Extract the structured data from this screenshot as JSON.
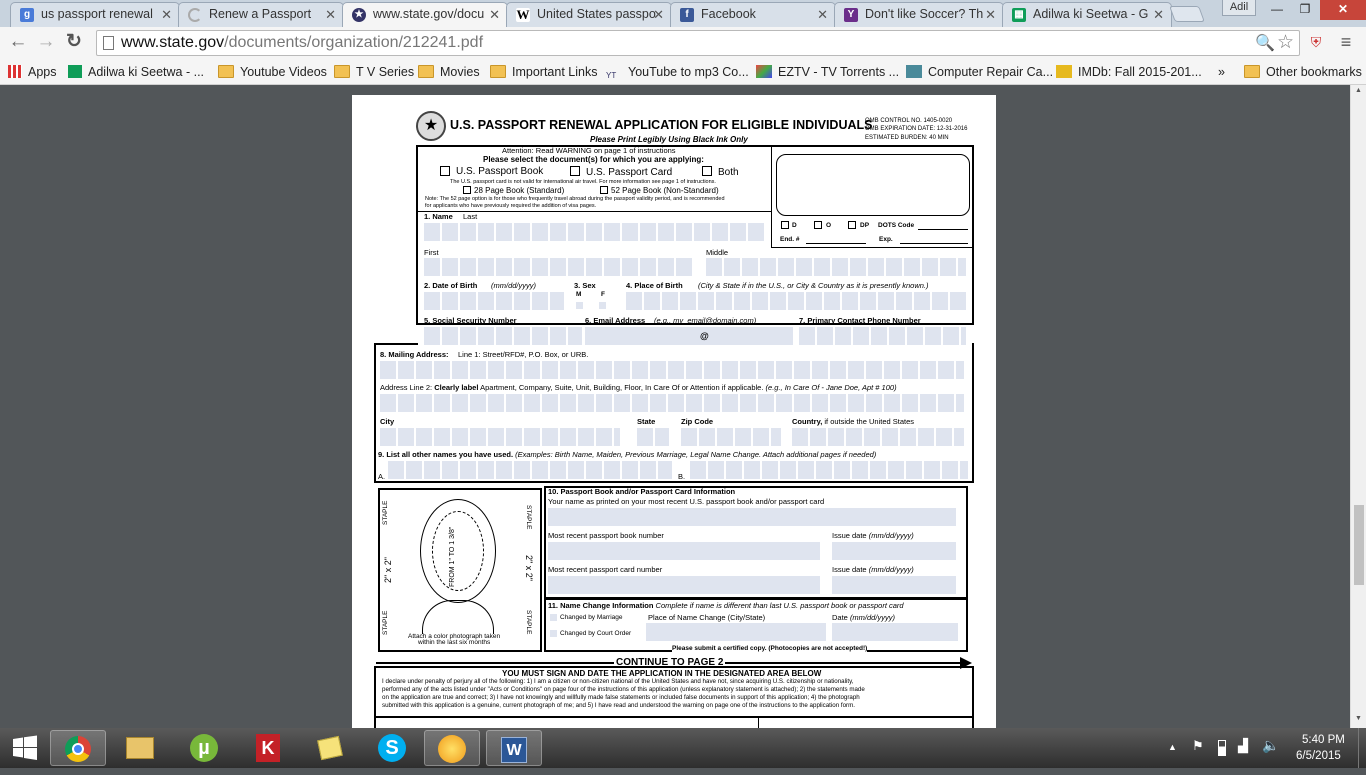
{
  "tabs": [
    {
      "label": "us passport renewal",
      "icon": "google-icon",
      "color": "#4a7bd8"
    },
    {
      "label": "Renew a Passport",
      "icon": "loading-icon",
      "color": "#999999"
    },
    {
      "label": "www.state.gov/docu",
      "icon": "state-seal-icon",
      "color": "#333366"
    },
    {
      "label": "United States passpo",
      "icon": "wikipedia-icon",
      "color": "#555555"
    },
    {
      "label": "Facebook",
      "icon": "facebook-icon",
      "color": "#3b5998"
    },
    {
      "label": "Don't like Soccer? Th",
      "icon": "yahoo-icon",
      "color": "#6b2e8a"
    },
    {
      "label": "Adilwa ki Seetwa - G",
      "icon": "sheets-icon",
      "color": "#0f9d58"
    }
  ],
  "window": {
    "user": "Adil",
    "minimize": "—",
    "restore": "❐",
    "close": "✕"
  },
  "toolbar": {
    "back": "←",
    "forward": "→",
    "reload": "↻",
    "url_host": "www.state.gov",
    "url_path": "/documents/organization/212241.pdf",
    "zoom": "🔍",
    "star": "☆",
    "menu": "≡"
  },
  "bookmarks": [
    {
      "label": "Apps",
      "type": "apps"
    },
    {
      "label": "Adilwa ki Seetwa - ...",
      "type": "sheets"
    },
    {
      "label": "Youtube Videos",
      "type": "folder"
    },
    {
      "label": "T V Series",
      "type": "folder"
    },
    {
      "label": "Movies",
      "type": "folder"
    },
    {
      "label": "Important Links",
      "type": "folder"
    },
    {
      "label": "YouTube to mp3 Co...",
      "type": "yt"
    },
    {
      "label": "EZTV - TV Torrents ...",
      "type": "eztv"
    },
    {
      "label": "Computer Repair Ca...",
      "type": "hj"
    },
    {
      "label": "IMDb: Fall 2015-201...",
      "type": "imdb"
    },
    {
      "label": "»",
      "type": "more"
    },
    {
      "label": "Other bookmarks",
      "type": "folder"
    }
  ],
  "form": {
    "title": "U.S. PASSPORT RENEWAL APPLICATION FOR ELIGIBLE INDIVIDUALS",
    "print_note": "Please Print Legibly Using Black Ink Only",
    "omb1": "OMB CONTROL NO. 1405-0020",
    "omb2": "OMB EXPIRATION DATE:  12-31-2016",
    "omb3": "ESTIMATED BURDEN: 40 MIN",
    "attention": "Attention: Read WARNING on page 1 of instructions",
    "select_docs": "Please select the document(s) for which you are applying:",
    "opt_book": "U.S. Passport Book",
    "opt_card": "U.S. Passport Card",
    "opt_both": "Both",
    "card_note": "The U.S. passport card is not valid for international air travel. For more information see page 1 of instructions.",
    "opt_28": "28 Page Book (Standard)",
    "opt_52": "52 Page Book (Non-Standard)",
    "note": "Note: The 52 page option is for those who frequently travel abroad during the passport validity period, and is recommended",
    "note2": "for applicants who have previously required the addition of visa pages.",
    "d": "D",
    "o": "O",
    "dp": "DP",
    "dots": "DOTS Code",
    "end": "End. #",
    "exp": "Exp.",
    "f1": "1.  Name",
    "last": "Last",
    "first": "First",
    "middle": "Middle",
    "f2": "2.  Date of Birth",
    "f2i": "(mm/dd/yyyy)",
    "f3": "3.  Sex",
    "m": "M",
    "f": "F",
    "f4": "4.  Place of Birth",
    "f4i": "(City & State if in the U.S., or City & Country as it is presently known.)",
    "f5": "5.  Social Security Number",
    "f6": "6. Email Address",
    "f6i": "(e.g., my_email@domain.com)",
    "at": "@",
    "f7": "7. Primary Contact Phone Number",
    "f8": "8. Mailing Address:",
    "f8r": "Line 1: Street/RFD#, P.O. Box, or URB.",
    "addr2a": "Address Line 2:",
    "addr2b": "Clearly label",
    "addr2c": "Apartment, Company, Suite, Unit, Building, Floor, In Care Of or Attention if applicable.",
    "addr2d": "(e.g., In Care Of - Jane Doe, Apt # 100)",
    "city": "City",
    "state": "State",
    "zip": "Zip Code",
    "country": "Country,",
    "country2": "if outside the United States",
    "f9": "9. List all other names you have used.",
    "f9i": "(Examples: Birth Name, Maiden, Previous Marriage, Legal Name Change.  Attach additional  pages if needed)",
    "a": "A.",
    "b": "B.",
    "staple": "STAPLE",
    "size": "2\" x 2\"",
    "from": "FROM 1\" TO 1 3/8\"",
    "attach1": "Attach a color photograph taken",
    "attach2": "within the last six months",
    "f10": "10. Passport Book and/or Passport Card Information",
    "f10a": "Your name as printed on your most recent U.S. passport book and/or passport card",
    "book_num": "Most recent passport book number",
    "issue": "Issue date",
    "issue_i": "(mm/dd/yyyy)",
    "card_num": "Most recent passport card number",
    "f11": "11. Name Change Information",
    "f11i": "Complete if name is different than last U.S. passport book or passport card",
    "marriage": "Changed by Marriage",
    "court": "Changed by Court Order",
    "place_change": "Place of Name Change (City/State)",
    "date": "Date",
    "date_i": "(mm/dd/yyyy)",
    "certified": "Please submit a certified copy.  (Photocopies are not accepted!)",
    "continue": "CONTINUE TO PAGE 2",
    "sign": "YOU MUST SIGN AND DATE THE APPLICATION IN THE DESIGNATED AREA BELOW",
    "decl1": "I declare under penalty of perjury all of the following: 1) I am a citizen or non-citizen national of the United States and have not, since acquiring U.S. citizenship or nationality,",
    "decl2": "performed any of the acts listed under \"Acts or Conditions\" on page four of the instructions of this application (unless explanatory statement is attached); 2) the statements made",
    "decl3": "on the application are true and correct; 3) I have not knowingly and willfully made false statements or included false documents in support of this application; 4) the photograph",
    "decl4": "submitted with this application is a genuine, current photograph of me; and 5) I have read and understood the warning on page one of the instructions to the application form."
  },
  "taskbar": {
    "time": "5:40 PM",
    "date": "6/5/2015"
  }
}
